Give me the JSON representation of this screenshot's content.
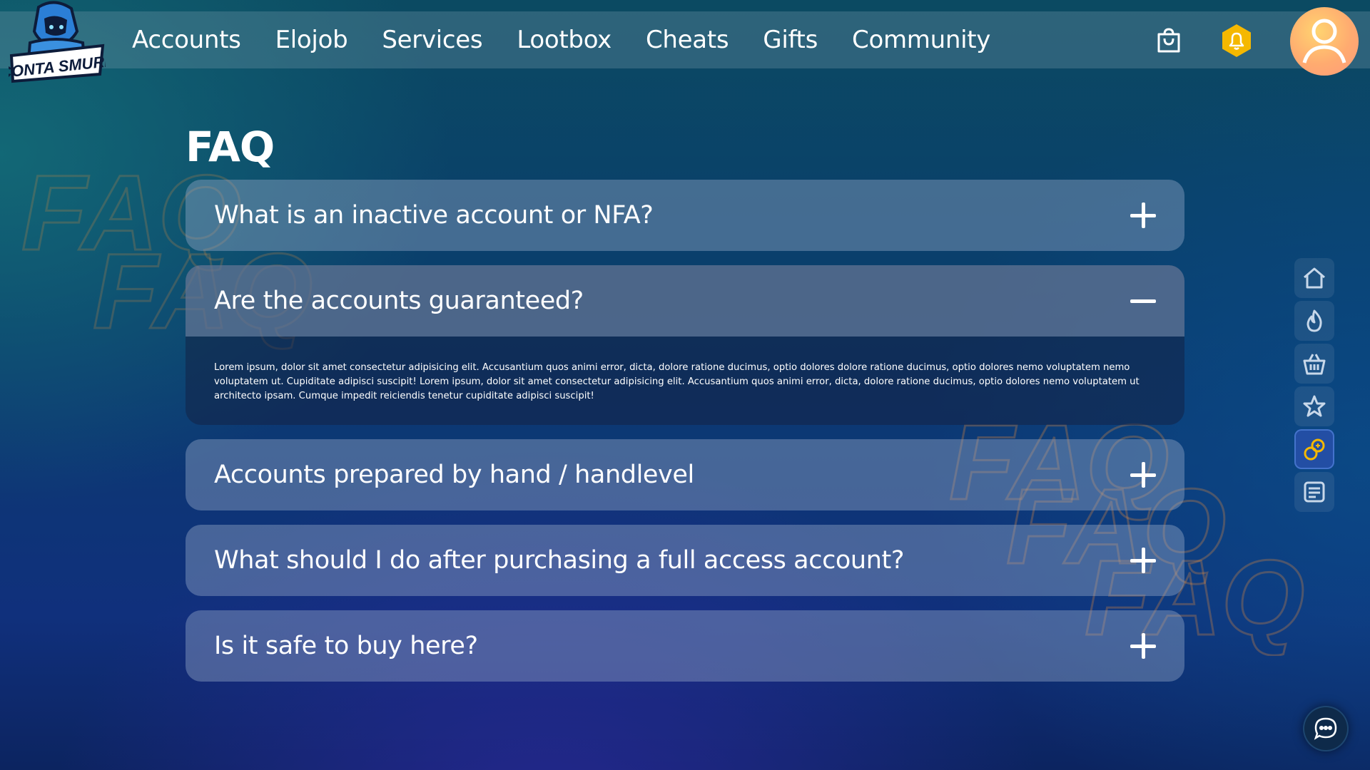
{
  "header": {
    "logo_text": "CONTA SMURF",
    "nav": [
      "Accounts",
      "Elojob",
      "Services",
      "Lootbox",
      "Cheats",
      "Gifts",
      "Community"
    ],
    "accent_color": "#f5b800"
  },
  "watermark_text": "FAQ",
  "faq": {
    "title": "FAQ",
    "items": [
      {
        "question": "What is an inactive account or NFA?",
        "state": "collapsed"
      },
      {
        "question": "Are the accounts guaranteed?",
        "state": "expanded",
        "answer": "Lorem ipsum, dolor sit amet consectetur adipisicing elit. Accusantium quos animi error, dicta, dolore ratione ducimus, optio dolores dolore ratione ducimus, optio dolores nemo voluptatem nemo voluptatem ut. Cupiditate adipisci suscipit! Lorem ipsum, dolor sit amet consectetur adipisicing elit. Accusantium quos animi error, dicta, dolore ratione ducimus, optio dolores nemo voluptatem ut architecto ipsam. Cumque impedit reiciendis tenetur cupiditate adipisci suscipit!"
      },
      {
        "question": "Accounts prepared by hand / handlevel",
        "state": "collapsed"
      },
      {
        "question": "What should I do after purchasing a full access account?",
        "state": "collapsed"
      },
      {
        "question": "Is it safe to buy here?",
        "state": "collapsed"
      }
    ]
  },
  "sidebar": {
    "items": [
      "home-icon",
      "fire-icon",
      "basket-icon",
      "star-icon",
      "coins-icon",
      "news-icon"
    ],
    "active": "coins-icon"
  },
  "icons": {
    "cart": "shopping-bag-icon",
    "notifications": "bell-icon",
    "avatar": "user-avatar",
    "chat": "chat-icon"
  }
}
